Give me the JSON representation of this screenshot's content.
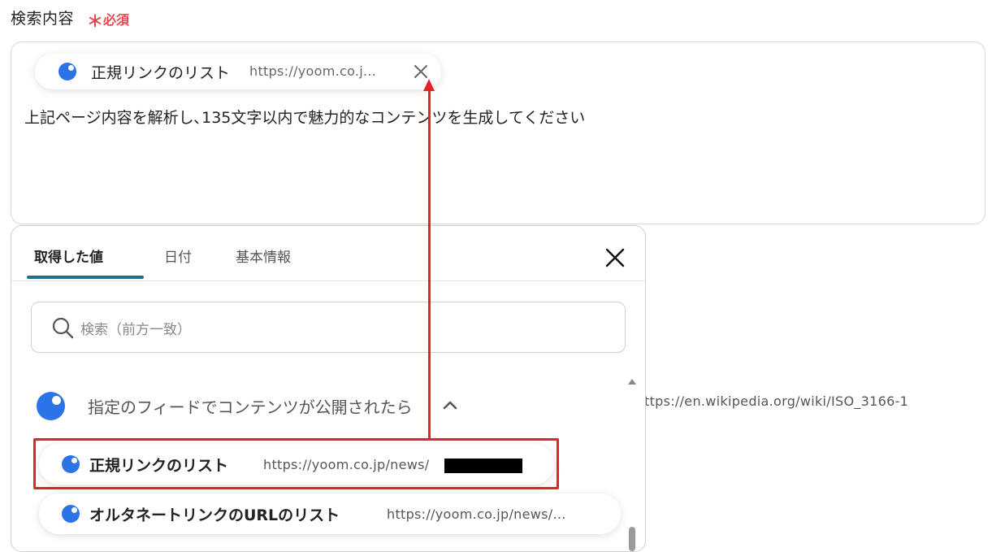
{
  "field": {
    "label": "検索内容",
    "required_star": "＊",
    "required_text": "必須"
  },
  "editor": {
    "chip": {
      "label": "正規リンクのリスト",
      "url": "https://yoom.co.j..."
    },
    "text": "上記ページ内容を解析し､135文字以内で魅力的なコンテンツを生成してください"
  },
  "background_text": {
    "url_fragment": "ttps://en.wikipedia.org/wiki/ISO_3166-1"
  },
  "picker": {
    "tabs": [
      {
        "label": "取得した値"
      },
      {
        "label": "日付"
      },
      {
        "label": "基本情報"
      }
    ],
    "search": {
      "placeholder": "検索（前方一致）"
    },
    "group": {
      "label": "指定のフィードでコンテンツが公開されたら"
    },
    "items": [
      {
        "label": "正規リンクのリスト",
        "url": "https://yoom.co.jp/news/"
      },
      {
        "label": "オルタネートリンクのURLのリスト",
        "url": "https://yoom.co.jp/news/..."
      }
    ]
  },
  "colors": {
    "accent": "#2b73e6",
    "annotation": "#e0242a",
    "tab_underline": "#1f6f87",
    "required": "#e5484d"
  }
}
